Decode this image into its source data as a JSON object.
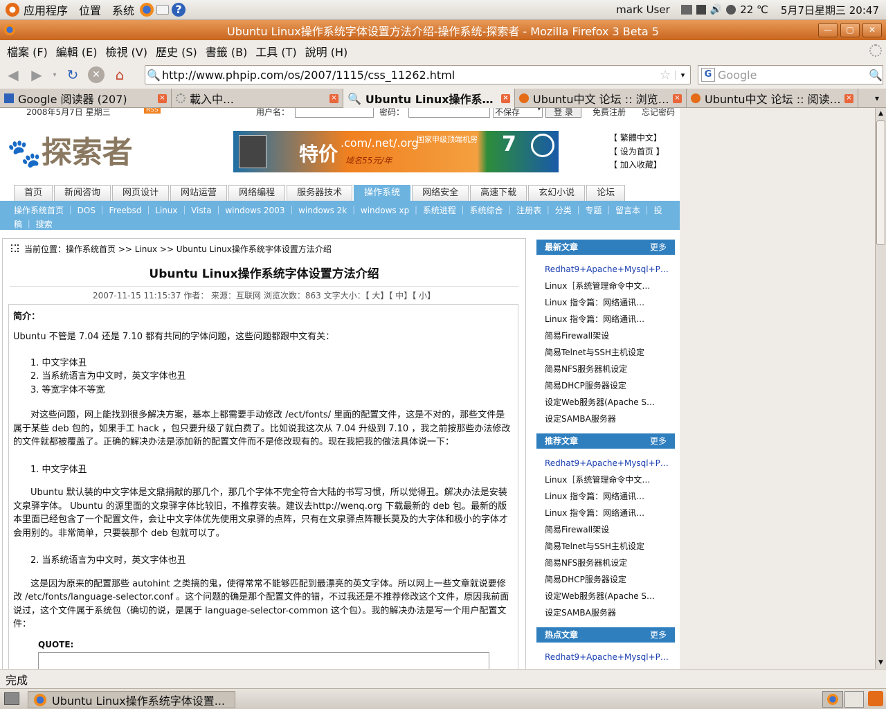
{
  "panel": {
    "apps": "应用程序",
    "places": "位置",
    "system": "系统",
    "user": "mark User",
    "temp": "22 ℃",
    "datetime": "5月7日星期三 20:47"
  },
  "window": {
    "title": "Ubuntu Linux操作系统字体设置方法介绍-操作系统-探索者 - Mozilla Firefox 3 Beta 5"
  },
  "menu": [
    "檔案 (F)",
    "編輯 (E)",
    "檢視 (V)",
    "歷史 (S)",
    "書籤 (B)",
    "工具 (T)",
    "說明 (H)"
  ],
  "url": "http://www.phpip.com/os/2007/1115/css_11262.html",
  "search_placeholder": "Google",
  "tabs": [
    {
      "label": "Google 阅读器 (207)"
    },
    {
      "label": "載入中…"
    },
    {
      "label": "Ubuntu Linux操作系…"
    },
    {
      "label": "Ubuntu中文 论坛 :: 浏览…"
    },
    {
      "label": "Ubuntu中文 论坛 :: 阅读…"
    }
  ],
  "site": {
    "date": "2008年5月7日 星期三",
    "username_label": "用户名：",
    "password_label": "密码：",
    "nosave": "不保存",
    "login": "登 录",
    "register": "免费注册",
    "forgot": "忘记密码",
    "logo": "探索者",
    "banner_text": ".com/.net/.org",
    "banner_big": "特价",
    "banner_small": "域名55元/年",
    "banner_right": "国家甲级顶端机房",
    "top_links": [
      "【 繁體中文】",
      "【 设为首页 】",
      "【 加入收藏】"
    ],
    "nav": [
      "首页",
      "新闻咨询",
      "网页设计",
      "网站运营",
      "网络编程",
      "服务器技术",
      "操作系统",
      "网络安全",
      "高速下载",
      "玄幻小说",
      "论坛"
    ],
    "subnav": "操作系统首页 ｜ DOS ｜ Freebsd ｜ Linux ｜ Vista ｜ windows 2003 ｜ windows 2k ｜ windows xp ｜ 系统进程 ｜ 系统综合 ｜ 注册表 ｜ 分类 ｜ 专题 ｜ 留言本 ｜ 投稿 ｜ 搜索"
  },
  "article": {
    "breadcrumb": "当前位置：操作系统首页 >> Linux >> Ubuntu Linux操作系统字体设置方法介绍",
    "title": "Ubuntu Linux操作系统字体设置方法介绍",
    "meta": "2007-11-15 11:15:37  作者：  来源：互联网  浏览次数：863  文字大小：【 大】【 中】【 小】",
    "intro_label": "简介：",
    "p1": "Ubuntu 不管是 7.04 还是 7.10 都有共同的字体问题，这些问题都跟中文有关：",
    "list": [
      "1. 中文字体丑",
      "2. 当系统语言为中文时，英文字体也丑",
      "3. 等宽字体不等宽"
    ],
    "p2": "对这些问题，网上能找到很多解决方案，基本上都需要手动修改 /ect/fonts/ 里面的配置文件，这是不对的，那些文件是属于某些 deb 包的，如果手工 hack ，包只要升级了就白费了。比如说我这次从 7.04 升级到 7.10 ，我之前按那些办法修改的文件就都被覆盖了。正确的解决办法是添加新的配置文件而不是修改现有的。现在我把我的做法具体说一下：",
    "h1": "1. 中文字体丑",
    "p3": "Ubuntu 默认装的中文字体是文鼎捐献的那几个，那几个字体不完全符合大陆的书写习惯，所以觉得丑。解决办法是安装文泉驿字体。 Ubuntu 的源里面的文泉驿字体比较旧，不推荐安装。建议去http://wenq.org 下载最新的 deb 包。最新的版本里面已经包含了一个配置文件，会让中文字体优先使用文泉驿的点阵，只有在文泉驿点阵鞭长莫及的大字体和极小的字体才会用别的。非常简单，只要装那个 deb 包就可以了。",
    "h2": "2. 当系统语言为中文时，英文字体也丑",
    "p4": "这是因为原来的配置那些 autohint 之类搞的鬼，使得常常不能够匹配到最漂亮的英文字体。所以网上一些文章就说要修改 /etc/fonts/language-selector.conf 。这个问题的确是那个配置文件的错，不过我还是不推荐修改这个文件，原因我前面说过，这个文件属于系统包（确切的说，是属于 language-selector-common 这个包）。我的解决办法是写一个用户配置文件：",
    "quote": "QUOTE:"
  },
  "sidebar": {
    "more": "更多",
    "sections": [
      {
        "title": "最新文章",
        "items": [
          "Redhat9+Apache+Mysql+P…",
          "Linux［系统管理命令中文…",
          "Linux 指令篇：网络通讯…",
          "Linux 指令篇：网络通讯…",
          "简易Firewall架设",
          "简易Telnet与SSH主机设定",
          "简易NFS服务器机设定",
          "简易DHCP服务器设定",
          "设定Web服务器(Apache S…",
          "设定SAMBA服务器"
        ]
      },
      {
        "title": "推荐文章",
        "items": [
          "Redhat9+Apache+Mysql+P…",
          "Linux［系统管理命令中文…",
          "Linux 指令篇：网络通讯…",
          "Linux 指令篇：网络通讯…",
          "简易Firewall架设",
          "简易Telnet与SSH主机设定",
          "简易NFS服务器机设定",
          "简易DHCP服务器设定",
          "设定Web服务器(Apache S…",
          "设定SAMBA服务器"
        ]
      },
      {
        "title": "热点文章",
        "items": [
          "Redhat9+Apache+Mysql+P…"
        ]
      }
    ]
  },
  "status": "完成",
  "taskbar": {
    "task": "Ubuntu Linux操作系统字体设置..."
  }
}
